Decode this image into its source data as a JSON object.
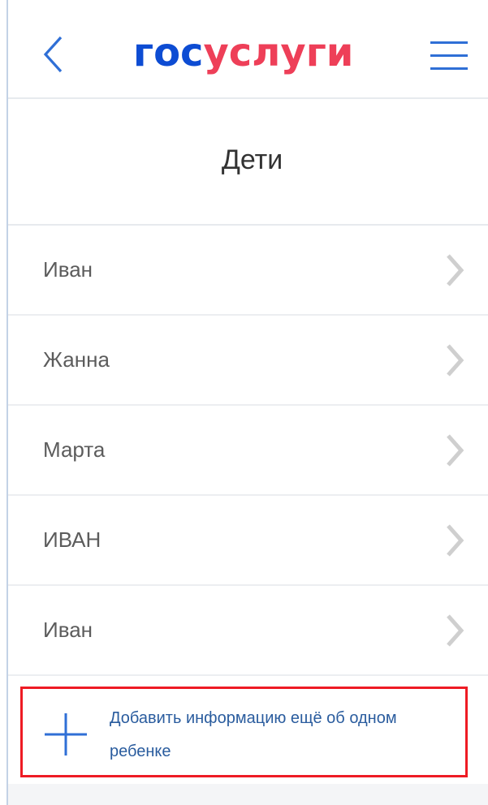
{
  "header": {
    "logo_part1": "гос",
    "logo_part2": "услуги",
    "back_icon": "chevron-left-icon",
    "menu_icon": "hamburger-menu-icon",
    "accent_color": "#0d4cd3",
    "brand_red": "#ee3f58"
  },
  "page": {
    "title": "Дети"
  },
  "children": [
    {
      "name": "Иван"
    },
    {
      "name": "Жанна"
    },
    {
      "name": "Марта"
    },
    {
      "name": "ИВАН"
    },
    {
      "name": "Иван"
    }
  ],
  "add_child": {
    "label": "Добавить информацию ещё об одном ребенке",
    "icon": "plus-icon",
    "highlight_color": "#ee1b24"
  }
}
